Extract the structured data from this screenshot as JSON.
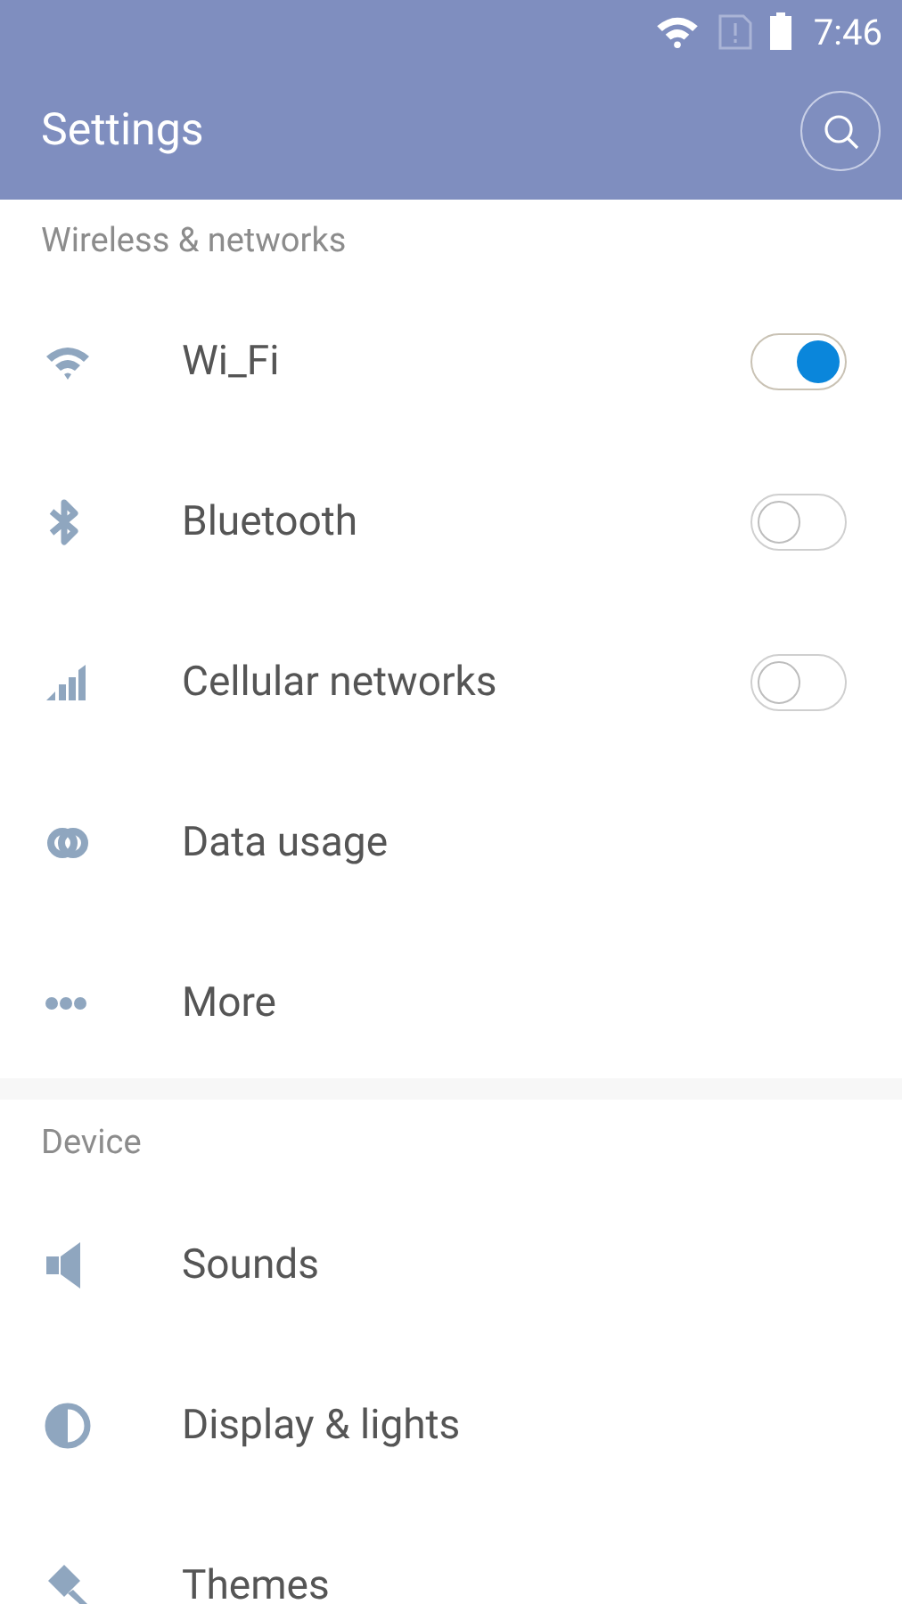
{
  "status_bar": {
    "time": "7:46"
  },
  "header": {
    "title": "Settings"
  },
  "sections": [
    {
      "title": "Wireless & networks",
      "items": [
        {
          "label": "Wi_Fi",
          "kind": "toggle",
          "on": true
        },
        {
          "label": "Bluetooth",
          "kind": "toggle",
          "on": false
        },
        {
          "label": "Cellular networks",
          "kind": "toggle",
          "on": false
        },
        {
          "label": "Data usage",
          "kind": "link"
        },
        {
          "label": "More",
          "kind": "link"
        }
      ]
    },
    {
      "title": "Device",
      "items": [
        {
          "label": "Sounds",
          "kind": "link"
        },
        {
          "label": "Display & lights",
          "kind": "link"
        },
        {
          "label": "Themes",
          "kind": "link"
        }
      ]
    }
  ]
}
